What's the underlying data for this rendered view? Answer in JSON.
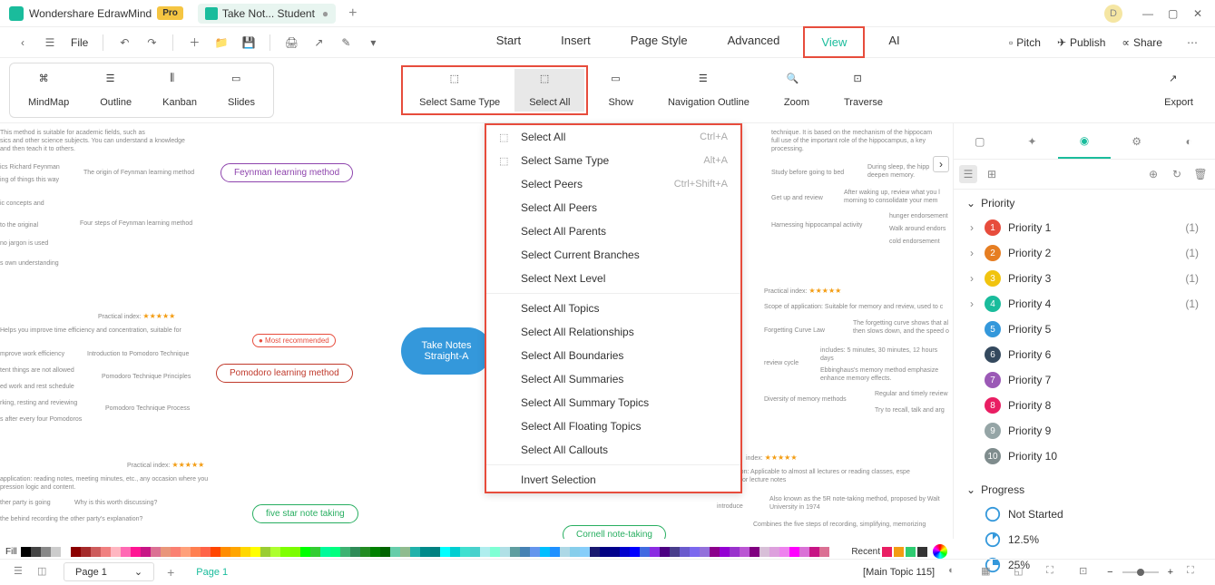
{
  "app": {
    "name": "Wondershare EdrawMind",
    "pro": "Pro",
    "tab_title": "Take Not... Student",
    "user_initial": "D"
  },
  "menu": {
    "file": "File",
    "tabs": [
      "Start",
      "Insert",
      "Page Style",
      "Advanced",
      "View",
      "AI"
    ],
    "active_tab": "View",
    "right": {
      "pitch": "Pitch",
      "publish": "Publish",
      "share": "Share"
    }
  },
  "ribbon": {
    "views": {
      "mindmap": "MindMap",
      "outline": "Outline",
      "kanban": "Kanban",
      "slides": "Slides"
    },
    "select_same": "Select Same Type",
    "select_all": "Select All",
    "show": "Show",
    "nav_outline": "Navigation Outline",
    "zoom": "Zoom",
    "traverse": "Traverse",
    "export": "Export"
  },
  "dropdown": [
    {
      "icon": true,
      "label": "Select All",
      "shortcut": "Ctrl+A"
    },
    {
      "icon": true,
      "label": "Select Same Type",
      "shortcut": "Alt+A"
    },
    {
      "label": "Select Peers",
      "shortcut": "Ctrl+Shift+A"
    },
    {
      "label": "Select All Peers"
    },
    {
      "label": "Select All Parents"
    },
    {
      "label": "Select Current Branches"
    },
    {
      "label": "Select Next Level"
    },
    {
      "sep": true
    },
    {
      "label": "Select All Topics"
    },
    {
      "label": "Select All Relationships"
    },
    {
      "label": "Select All Boundaries"
    },
    {
      "label": "Select All Summaries"
    },
    {
      "label": "Select All Summary Topics"
    },
    {
      "label": "Select All Floating Topics"
    },
    {
      "label": "Select All Callouts"
    },
    {
      "sep": true
    },
    {
      "label": "Invert Selection"
    }
  ],
  "canvas": {
    "center": "Take Notes Straight-A",
    "feynman": "Feynman learning method",
    "pomodoro": "Pomodoro learning method",
    "fivestar": "five star note taking",
    "cornell": "Cornell note-taking",
    "recommend": "● Most recommended",
    "leaves": {
      "l1": "This method is suitable for academic fields, such as",
      "l2": "sics and other science subjects. You can understand a knowledge",
      "l3": "and then teach it to others.",
      "l4": "ics Richard Feynman",
      "l5": "ing of things this way",
      "l6": "The origin of Feynman learning method",
      "l7": "ic concepts and",
      "l8": "to the original",
      "l9": "Four steps of Feynman learning method",
      "l10": "no jargon is used",
      "l11": "s own understanding",
      "p1": "Practical index:",
      "p2": "Helps you improve time efficiency and concentration, suitable for",
      "p3": "mprove work efficiency",
      "p4": "Introduction to Pomodoro Technique",
      "p5": "tent things are not allowed",
      "p6": "Pomodoro Technique Principles",
      "p7": "ed work and rest schedule",
      "p8": "rking, resting and reviewing",
      "p9": "Pomodoro Technique Process",
      "p10": "s after every four Pomodoros",
      "f1": "Practical index:",
      "f2": "application: reading notes, meeting minutes, etc., any occasion where you",
      "f3": "pression logic and content.",
      "f4": "ther party is going",
      "f5": "Why is this worth discussing?",
      "f6": "the behind recording the other party's explanation?",
      "r1": "technique. It is based on the mechanism of the hippocam",
      "r2": "full use of the important role of the hippocampus, a key",
      "r3": "processing.",
      "r4": "Study before going to bed",
      "r5": "During sleep, the hipp",
      "r6": "deepen memory.",
      "r7": "Get up and review",
      "r8": "After waking up, review what you l",
      "r9": "morning to consolidate your mem",
      "r10": "Harnessing hippocampal activity",
      "r11": "hunger endorsement",
      "r12": "Walk around endors",
      "r13": "cold endorsement",
      "y1": "Practical index:",
      "y2": "Scope of application: Suitable for memory and review, used to c",
      "y3": "Forgetting Curve Law",
      "y4": "The forgetting curve shows that al",
      "y5": "then slows down, and the speed o",
      "y6": "review cycle",
      "y7": "includes: 5 minutes, 30 minutes, 12 hours",
      "y8": "days",
      "y9": "Ebbinghaus's memory method emphasize",
      "y10": "enhance memory effects.",
      "y11": "Diversity of memory methods",
      "y12": "Regular and timely review",
      "y13": "Try to recall, talk and arg",
      "g1": "index:",
      "g2": "application: Applicable to almost all lectures or reading classes, espe",
      "g3": "suitable for lecture notes",
      "g4": "introduce",
      "g5": "Also known as the 5R note-taking method, proposed by Walt",
      "g6": "University in 1974",
      "g7": "Combines the five steps of recording, simplifying, memorizing"
    }
  },
  "right_panel": {
    "priority_head": "Priority",
    "priorities": [
      {
        "n": 1,
        "label": "Priority 1",
        "count": "(1)"
      },
      {
        "n": 2,
        "label": "Priority 2",
        "count": "(1)"
      },
      {
        "n": 3,
        "label": "Priority 3",
        "count": "(1)"
      },
      {
        "n": 4,
        "label": "Priority 4",
        "count": "(1)"
      },
      {
        "n": 5,
        "label": "Priority 5"
      },
      {
        "n": 6,
        "label": "Priority 6"
      },
      {
        "n": 7,
        "label": "Priority 7"
      },
      {
        "n": 8,
        "label": "Priority 8"
      },
      {
        "n": 9,
        "label": "Priority 9"
      },
      {
        "n": 10,
        "label": "Priority 10"
      }
    ],
    "progress_head": "Progress",
    "progress": [
      {
        "label": "Not Started"
      },
      {
        "label": "12.5%"
      },
      {
        "label": "25%"
      }
    ]
  },
  "colorbar": {
    "fill": "Fill",
    "recent": "Recent"
  },
  "status": {
    "page_dd": "Page 1",
    "page_tab": "Page 1",
    "main_topic": "[Main Topic 115]",
    "zoom": "—"
  }
}
